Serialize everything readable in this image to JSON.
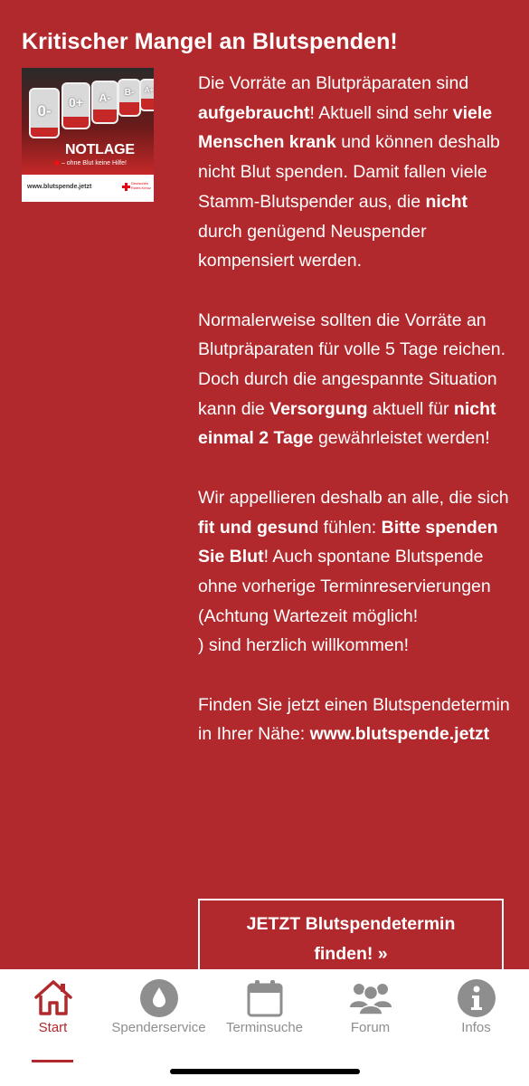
{
  "title": "Kritischer Mangel an Blutspenden!",
  "banner": {
    "bags": [
      "0-",
      "0+",
      "A-",
      "B-",
      "A+"
    ],
    "headline": "NOTLAGE",
    "subline": "– ohne Blut keine Hilfe!",
    "url": "www.blutspende.jetzt",
    "org": "Deutsches Rotes Kreuz"
  },
  "paragraphs": {
    "p1": {
      "t1": "Die Vorräte an Blutpräparaten sind ",
      "b1": "aufgebraucht",
      "t2": "! Aktuell sind sehr ",
      "b2": "viele Menschen krank",
      "t3": " und können deshalb nicht Blut spenden. Damit fallen viele Stamm-Blutspender aus, die ",
      "b3": "nicht",
      "t4": " durch genügend Neuspender kompensiert werden."
    },
    "p2": {
      "t1": "Normalerweise sollten die Vorräte an Blutpräparaten für volle 5 Tage reichen. Doch durch die angespannte Situation kann die ",
      "b1": "Versorgung",
      "t2": " aktuell für ",
      "b2": "nicht einmal 2 Tage",
      "t3": " gewährleistet werden!"
    },
    "p3": {
      "t1": "Wir appellieren deshalb an alle, die sich ",
      "b1": "fit und gesun",
      "t2": "d fühlen: ",
      "b2": "Bitte spenden Sie Blut",
      "t3": "! Auch spontane Blutspende ohne vorherige Terminreservierungen",
      "t4": "(Achtung Wartezeit möglich!",
      "t5": ") sind herzlich willkommen!"
    },
    "p4": {
      "t1": "Finden Sie jetzt einen Blutspendetermin in Ihrer Nähe: ",
      "b1": "www.blutspende.jetzt"
    }
  },
  "cta": {
    "line1": "JETZT Blutspendetermin",
    "line2": "finden! »"
  },
  "tabs": [
    {
      "label": "Start",
      "icon": "home-icon",
      "active": true
    },
    {
      "label": "Spenderservice",
      "icon": "drop-icon",
      "active": false
    },
    {
      "label": "Terminsuche",
      "icon": "calendar-icon",
      "active": false
    },
    {
      "label": "Forum",
      "icon": "group-icon",
      "active": false
    },
    {
      "label": "Infos",
      "icon": "info-icon",
      "active": false
    }
  ],
  "colors": {
    "background": "#b1292d",
    "active_tab": "#b1292d",
    "inactive_tab": "#8e8e8e"
  }
}
